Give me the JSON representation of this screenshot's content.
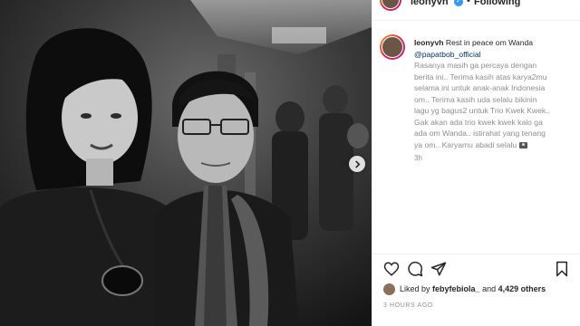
{
  "post": {
    "username": "leonyvh",
    "verified_mark": "✓",
    "separator": "•",
    "follow_label": "Following",
    "caption_lead": "Rest in peace om Wanda",
    "mention": "@papatbob_official",
    "caption_lines": [
      "Rasanya masih ga percaya dengan",
      "berita ini.. Terima kasih atas karya2mu",
      "selama ini untuk anak-anak Indonesia",
      "om.. Terima kasih uda selalu bikinin",
      "lagu yg bagus2 untuk Trio Kwek Kwek..",
      "Gak akan ada trio kwek kwek kalo ga",
      "ada om Wanda.. istirahat yang tenang",
      "ya om.. Karyamu abadi selalu"
    ],
    "caption_time": "3h",
    "likes_prefix": "Liked by",
    "likes_user": "febyfebiola_",
    "likes_and": "and",
    "likes_count": "4,429 others",
    "post_time": "3 HOURS AGO"
  },
  "icons": {
    "heart": "heart-icon",
    "comment": "comment-icon",
    "share": "share-icon",
    "save": "bookmark-icon",
    "next": "chevron-right-icon",
    "camera": "camera-emoji-icon"
  },
  "colors": {
    "text": "#262626",
    "muted": "#8e8e8e",
    "verified": "#3897f0",
    "mention": "#00376b"
  }
}
